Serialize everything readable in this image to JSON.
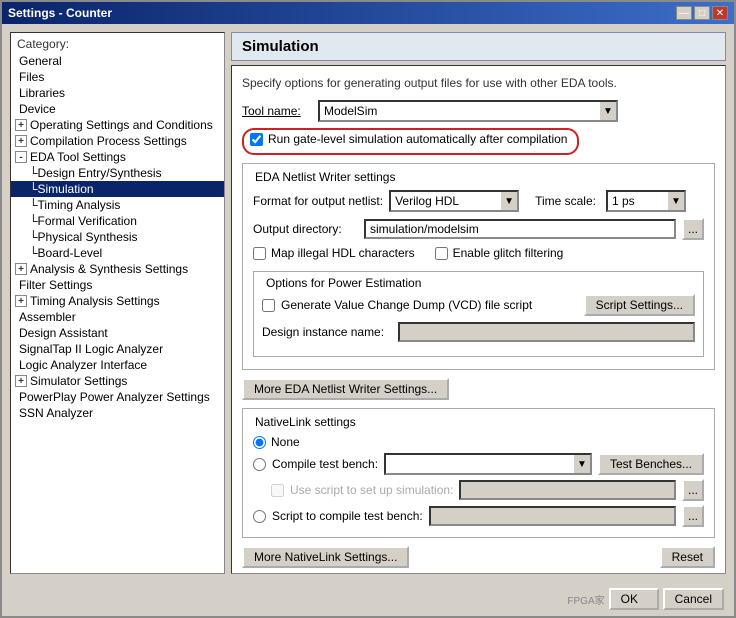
{
  "window": {
    "title": "Settings - Counter",
    "buttons": {
      "minimize": "—",
      "maximize": "□",
      "close": "✕"
    }
  },
  "sidebar": {
    "label": "Category:",
    "items": [
      {
        "id": "general",
        "label": "General",
        "indent": 0,
        "expandable": false
      },
      {
        "id": "files",
        "label": "Files",
        "indent": 0,
        "expandable": false
      },
      {
        "id": "libraries",
        "label": "Libraries",
        "indent": 0,
        "expandable": false
      },
      {
        "id": "device",
        "label": "Device",
        "indent": 0,
        "expandable": false
      },
      {
        "id": "operating",
        "label": "Operating Settings and Conditions",
        "indent": 0,
        "expandable": true,
        "expanded": false
      },
      {
        "id": "compilation",
        "label": "Compilation Process Settings",
        "indent": 0,
        "expandable": true,
        "expanded": false
      },
      {
        "id": "eda-tool",
        "label": "EDA Tool Settings",
        "indent": 0,
        "expandable": true,
        "expanded": true
      },
      {
        "id": "design-entry",
        "label": "Design Entry/Synthesis",
        "indent": 1,
        "expandable": false
      },
      {
        "id": "simulation",
        "label": "Simulation",
        "indent": 1,
        "expandable": false,
        "selected": true
      },
      {
        "id": "timing-analysis",
        "label": "Timing Analysis",
        "indent": 1,
        "expandable": false
      },
      {
        "id": "formal-verification",
        "label": "Formal Verification",
        "indent": 1,
        "expandable": false
      },
      {
        "id": "physical-synthesis",
        "label": "Physical Synthesis",
        "indent": 1,
        "expandable": false
      },
      {
        "id": "board-level",
        "label": "Board-Level",
        "indent": 1,
        "expandable": false
      },
      {
        "id": "analysis-synthesis",
        "label": "Analysis & Synthesis Settings",
        "indent": 0,
        "expandable": true,
        "expanded": false
      },
      {
        "id": "filter",
        "label": "Filter Settings",
        "indent": 0,
        "expandable": false
      },
      {
        "id": "timing-analysis-settings",
        "label": "Timing Analysis Settings",
        "indent": 0,
        "expandable": true,
        "expanded": false
      },
      {
        "id": "assembler",
        "label": "Assembler",
        "indent": 0,
        "expandable": false
      },
      {
        "id": "design-assistant",
        "label": "Design Assistant",
        "indent": 0,
        "expandable": false
      },
      {
        "id": "signaltap",
        "label": "SignalTap II Logic Analyzer",
        "indent": 0,
        "expandable": false
      },
      {
        "id": "logic-analyzer",
        "label": "Logic Analyzer Interface",
        "indent": 0,
        "expandable": false
      },
      {
        "id": "simulator",
        "label": "Simulator Settings",
        "indent": 0,
        "expandable": true,
        "expanded": false
      },
      {
        "id": "powerplay",
        "label": "PowerPlay Power Analyzer Settings",
        "indent": 0,
        "expandable": false
      },
      {
        "id": "ssn",
        "label": "SSN Analyzer",
        "indent": 0,
        "expandable": false
      }
    ]
  },
  "main": {
    "section_title": "Simulation",
    "description": "Specify options for generating output files for use with other EDA tools.",
    "tool_name_label": "Tool name:",
    "tool_name_value": "ModelSim",
    "run_gate_level_label": "Run gate-level simulation automatically after compilation",
    "run_gate_level_checked": true,
    "eda_netlist_group": "EDA Netlist Writer settings",
    "format_label": "Format for output netlist:",
    "format_value": "Verilog HDL",
    "timescale_label": "Time scale:",
    "timescale_value": "1 ps",
    "output_dir_label": "Output directory:",
    "output_dir_value": "simulation/modelsim",
    "map_illegal_label": "Map illegal HDL characters",
    "map_illegal_checked": false,
    "enable_glitch_label": "Enable glitch filtering",
    "enable_glitch_checked": false,
    "power_estimation_group": "Options for Power Estimation",
    "generate_vcd_label": "Generate Value Change Dump (VCD) file script",
    "generate_vcd_checked": false,
    "script_settings_label": "Script Settings...",
    "design_instance_label": "Design instance name:",
    "design_instance_value": "",
    "more_eda_btn": "More EDA Netlist Writer Settings...",
    "nativelink_group": "NativeLink settings",
    "none_label": "None",
    "none_selected": true,
    "compile_test_label": "Compile test bench:",
    "compile_test_selected": false,
    "test_benches_btn": "Test Benches...",
    "use_script_label": "Use script to set up simulation:",
    "use_script_selected": false,
    "script_compile_label": "Script to compile test bench:",
    "script_compile_selected": false,
    "more_nativelink_btn": "More NativeLink Settings...",
    "reset_btn": "Reset",
    "ok_btn": "OK",
    "cancel_btn": "Cancel",
    "watermark": "FPGA家"
  }
}
